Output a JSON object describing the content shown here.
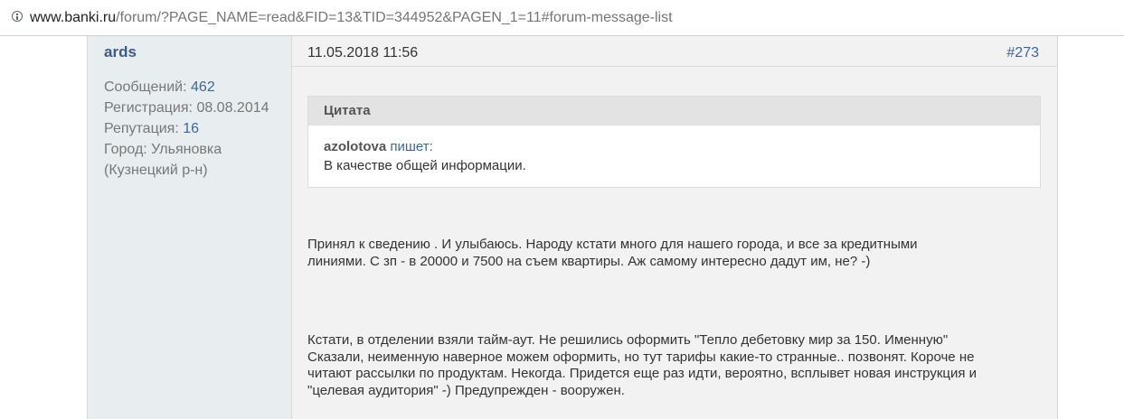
{
  "browser": {
    "url_host": "www.banki.ru",
    "url_path": "/forum/?PAGE_NAME=read&FID=13&TID=344952&PAGEN_1=11#forum-message-list"
  },
  "author": {
    "name": "ards",
    "messages_label": "Сообщений:",
    "messages_value": "462",
    "registration_label": "Регистрация:",
    "registration_value": "08.08.2014",
    "reputation_label": "Репутация:",
    "reputation_value": "16",
    "city_label": "Город:",
    "city_value": "Ульяновка",
    "city_extra": "(Кузнецкий р-н)"
  },
  "post": {
    "date": "11.05.2018 11:56",
    "number": "#273",
    "quote": {
      "title": "Цитата",
      "author": "azolotova",
      "writes": "пишет:",
      "text": "В качестве общей информации."
    },
    "paragraph1": [
      "Принял к сведению . И улыбаюсь. Народу кстати много для нашего города, и все за кредитными",
      "линиями. С зп - в 20000 и 7500 на съем квартиры. Аж самому интересно дадут им, не? -)"
    ],
    "paragraph2": [
      "Кстати, в отделении взяли тайм-аут. Не решились оформить \"Тепло дебетовку мир за 150. Именную\"",
      "Сказали, неименную наверное можем оформить, но тут тарифы какие-то странные.. позвонят. Короче не",
      "читают рассылки по продуктам. Некогда. Придется еще раз идти, вероятно, всплывет новая инструкция и",
      "\"целевая аудитория\" -) Предупрежден - вооружен."
    ]
  },
  "icons": {
    "address_info": "info-icon"
  }
}
